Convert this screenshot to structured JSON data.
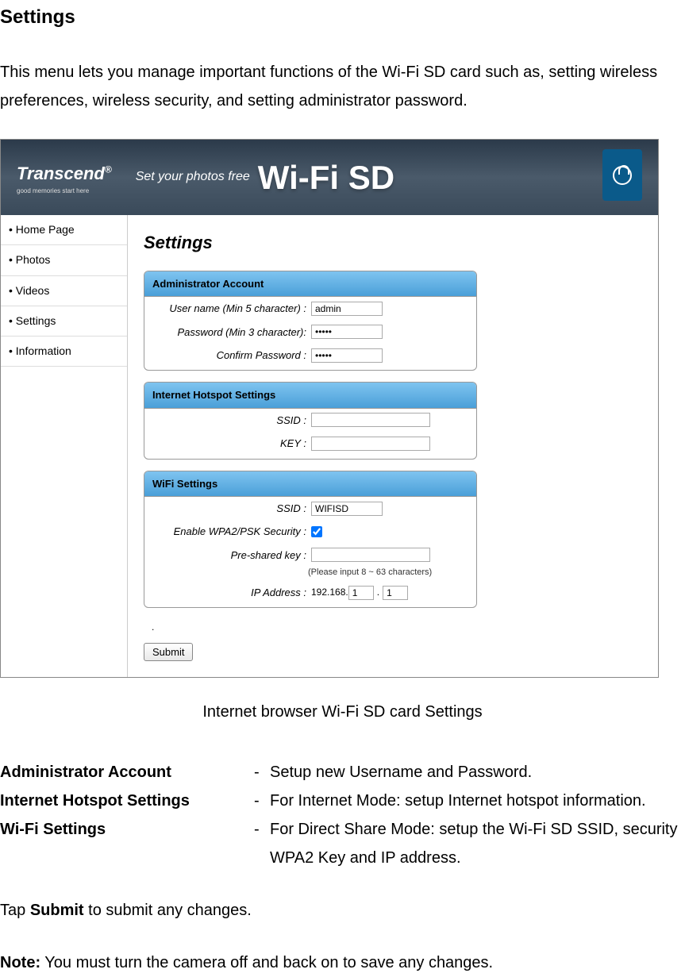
{
  "page": {
    "title": "Settings",
    "intro": "This menu lets you manage important functions of the Wi-Fi SD card such as, setting wireless preferences, wireless security, and setting administrator password.",
    "caption": "Internet browser Wi-Fi SD card Settings",
    "submit_instruction_prefix": "Tap ",
    "submit_instruction_bold": "Submit",
    "submit_instruction_suffix": " to submit any changes.",
    "note_prefix": "Note:",
    "note_text": " You must turn the camera off and back on to save any changes."
  },
  "banner": {
    "brand": "Transcend",
    "brand_suffix": "®",
    "brand_tagline": "good memories start here",
    "slogan": "Set your photos free",
    "product": "Wi-Fi SD"
  },
  "sidebar": {
    "items": [
      {
        "label": "• Home Page"
      },
      {
        "label": "• Photos"
      },
      {
        "label": "• Videos"
      },
      {
        "label": "• Settings"
      },
      {
        "label": "• Information"
      }
    ]
  },
  "settings_panel": {
    "title": "Settings",
    "sections": {
      "admin": {
        "header": "Administrator Account",
        "username_label": "User name (Min 5 character) :",
        "username_value": "admin",
        "password_label": "Password (Min 3 character):",
        "password_value": "•••••",
        "confirm_label": "Confirm Password :",
        "confirm_value": "•••••"
      },
      "hotspot": {
        "header": "Internet Hotspot Settings",
        "ssid_label": "SSID :",
        "ssid_value": "",
        "key_label": "KEY :",
        "key_value": ""
      },
      "wifi": {
        "header": "WiFi Settings",
        "ssid_label": "SSID :",
        "ssid_value": "WIFISD",
        "security_label": "Enable WPA2/PSK Security :",
        "security_checked": true,
        "psk_label": "Pre-shared key :",
        "psk_value": "",
        "psk_hint": "(Please input 8 ~ 63 characters)",
        "ip_label": "IP Address :",
        "ip_prefix": "192.168.",
        "ip_third": "1",
        "ip_fourth": "1"
      }
    },
    "submit_label": "Submit"
  },
  "descriptions": [
    {
      "label": "Administrator Account",
      "text": "Setup new Username and Password."
    },
    {
      "label": "Internet Hotspot Settings",
      "text": "For Internet Mode: setup Internet hotspot information."
    },
    {
      "label": "Wi-Fi Settings",
      "text": "For Direct Share Mode: setup the Wi-Fi SD SSID, security WPA2 Key and IP address."
    }
  ]
}
